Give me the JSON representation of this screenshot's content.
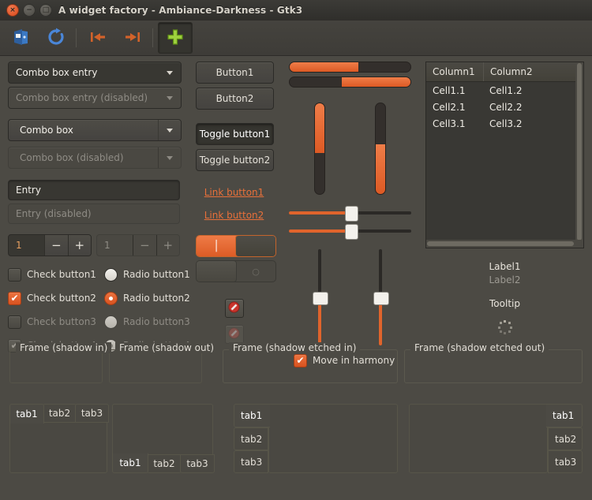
{
  "window": {
    "title": "A widget factory - Ambiance-Darkness - Gtk3",
    "controls": {
      "close": "×",
      "minimize": "−",
      "maximize": "□"
    }
  },
  "toolbar": {
    "items": [
      {
        "name": "open-icon",
        "label": "Open"
      },
      {
        "name": "refresh-icon",
        "label": "Refresh"
      },
      {
        "name": "goto-first-icon",
        "label": "Go to first"
      },
      {
        "name": "goto-last-icon",
        "label": "Go to last"
      },
      {
        "name": "add-icon",
        "label": "Add"
      }
    ]
  },
  "column1": {
    "combo_entry": {
      "value": "Combo box entry",
      "arrow": "▼"
    },
    "combo_entry_disabled": {
      "value": "Combo box entry (disabled)",
      "arrow": "▼"
    },
    "combo": {
      "value": "Combo box",
      "arrow": "▼"
    },
    "combo_disabled": {
      "value": "Combo box (disabled)",
      "arrow": "▼"
    },
    "entry": {
      "value": "Entry"
    },
    "entry_disabled": {
      "value": "Entry (disabled)"
    },
    "spin": {
      "value": "1",
      "minus": "−",
      "plus": "+"
    },
    "spin_disabled": {
      "value": "1",
      "minus": "−",
      "plus": "+"
    },
    "checks": [
      {
        "label": "Check button1",
        "checked": false,
        "disabled": false
      },
      {
        "label": "Check button2",
        "checked": true,
        "disabled": false
      },
      {
        "label": "Check button3",
        "checked": false,
        "disabled": true
      },
      {
        "label": "Check button4",
        "checked": true,
        "disabled": true
      }
    ],
    "radios": [
      {
        "label": "Radio button1",
        "selected": false,
        "disabled": false
      },
      {
        "label": "Radio button2",
        "selected": true,
        "disabled": false
      },
      {
        "label": "Radio button3",
        "selected": false,
        "disabled": true
      },
      {
        "label": "Radio button4",
        "selected": true,
        "disabled": true
      }
    ],
    "check_tick": "✔"
  },
  "column2": {
    "buttons": [
      {
        "label": "Button1",
        "active": false
      },
      {
        "label": "Button2",
        "active": false
      }
    ],
    "toggles": [
      {
        "label": "Toggle button1",
        "active": true
      },
      {
        "label": "Toggle button2",
        "active": false
      }
    ],
    "links": [
      {
        "label": "Link button1"
      },
      {
        "label": "Link button2"
      }
    ],
    "switch_on": {
      "mark": "│",
      "state": "on"
    },
    "switch_off": {
      "mark": "○",
      "state": "off"
    },
    "icon_buttons": [
      {
        "name": "stop-icon",
        "disabled": false
      },
      {
        "name": "stop-icon",
        "disabled": true
      }
    ]
  },
  "column3": {
    "progress_bars": [
      {
        "value": 57,
        "inverted": false
      },
      {
        "value": 57,
        "inverted": true
      }
    ],
    "vertical_progress": [
      {
        "value": 55,
        "inverted": false
      },
      {
        "value": 55,
        "inverted": true
      }
    ],
    "h_scales": [
      {
        "value": 50
      },
      {
        "value": 50
      }
    ],
    "v_scales": [
      {
        "value": 50
      },
      {
        "value": 50
      }
    ],
    "harmony": {
      "label": "Move in harmony",
      "checked": true,
      "tick": "✔"
    }
  },
  "column4": {
    "tree": {
      "headers": [
        "Column1",
        "Column2"
      ],
      "rows": [
        [
          "Cell1.1",
          "Cell1.2"
        ],
        [
          "Cell2.1",
          "Cell2.2"
        ],
        [
          "Cell3.1",
          "Cell3.2"
        ]
      ]
    },
    "labels": [
      {
        "text": "Label1",
        "disabled": false
      },
      {
        "text": "Label2",
        "disabled": true
      }
    ],
    "tooltip": {
      "text": "Tooltip"
    },
    "spinner": {
      "name": "spinner-icon"
    }
  },
  "frames": [
    {
      "label": "Frame (shadow in)"
    },
    {
      "label": "Frame (shadow out)"
    },
    {
      "label": "Frame (shadow etched in)"
    },
    {
      "label": "Frame (shadow etched out)"
    }
  ],
  "notebooks": [
    {
      "position": "top",
      "tabs": [
        "tab1",
        "tab2",
        "tab3"
      ],
      "selected": 0
    },
    {
      "position": "bottom",
      "tabs": [
        "tab1",
        "tab2",
        "tab3"
      ],
      "selected": 0
    },
    {
      "position": "left",
      "tabs": [
        "tab1",
        "tab2",
        "tab3"
      ],
      "selected": 0
    },
    {
      "position": "right",
      "tabs": [
        "tab1",
        "tab2",
        "tab3"
      ],
      "selected": 0
    }
  ],
  "colors": {
    "accent": "#dd5c26",
    "background": "#4c4a44",
    "titlebar": "#33322e",
    "text": "#dfdbd2",
    "text_disabled": "#8f8c85",
    "link": "#e8703a",
    "field": "#383732"
  }
}
